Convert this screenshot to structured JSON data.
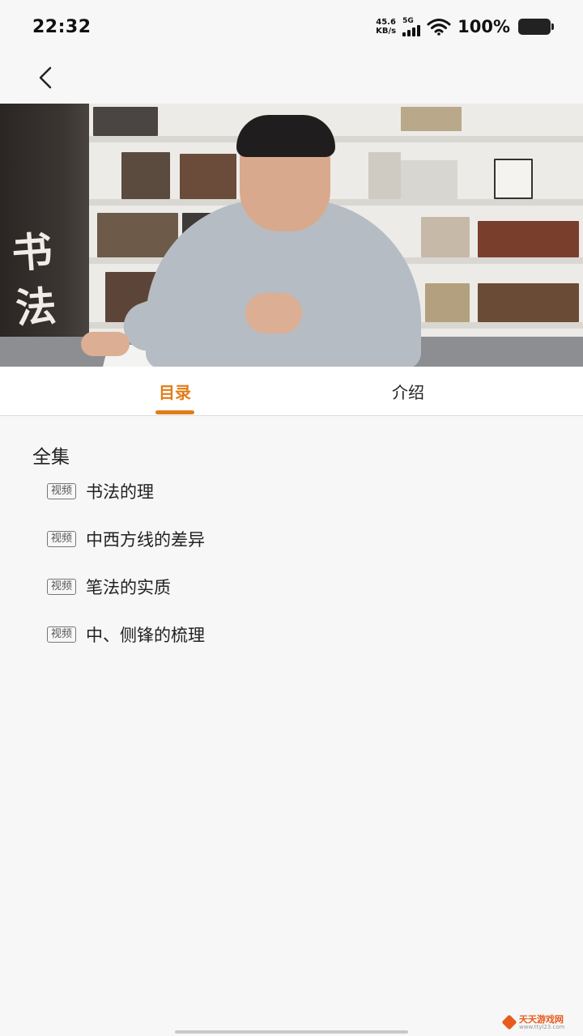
{
  "status_bar": {
    "time": "22:32",
    "net_speed_value": "45.6",
    "net_speed_unit": "KB/s",
    "network_type": "5G",
    "battery": "100%"
  },
  "video": {
    "side_text_1": "书",
    "side_text_2": "法"
  },
  "tabs": [
    {
      "label": "目录",
      "active": true
    },
    {
      "label": "介绍",
      "active": false
    }
  ],
  "catalog": {
    "section_title": "全集",
    "episodes": [
      {
        "tag": "视频",
        "title": "书法的理"
      },
      {
        "tag": "视频",
        "title": "中西方线的差异"
      },
      {
        "tag": "视频",
        "title": "笔法的实质"
      },
      {
        "tag": "视频",
        "title": "中、侧锋的梳理"
      }
    ]
  },
  "watermark": {
    "text": "天天游戏网",
    "url": "www.ttyl23.com"
  },
  "colors": {
    "accent": "#e07d1a",
    "background": "#f7f7f7"
  }
}
